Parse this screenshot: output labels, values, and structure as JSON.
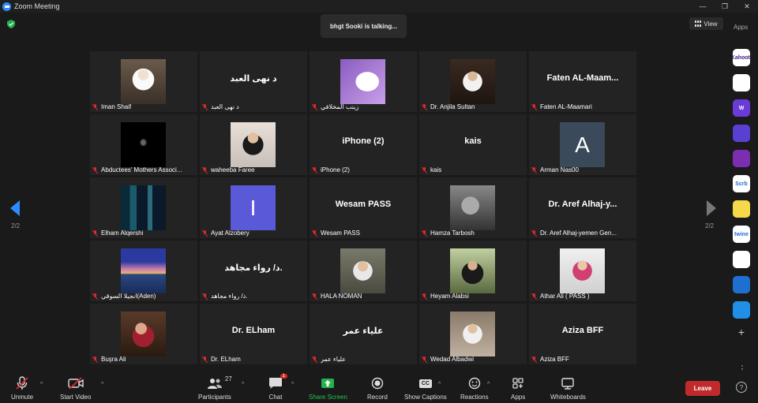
{
  "window": {
    "title": "Zoom Meeting"
  },
  "talking": "bhgt Sooki is talking...",
  "view_label": "View",
  "apps_label": "Apps",
  "pagination": {
    "left": "2/2",
    "right": "2/2"
  },
  "colors": {
    "accent": "#2d8cff",
    "leave": "#c12a2a",
    "muted": "#e02828"
  },
  "tiles": [
    {
      "name": "Iman Shaif",
      "type": "photo",
      "thumb": "woman-hijab-white"
    },
    {
      "name": "د نهى العبد",
      "big": "د نهى العبد",
      "type": "text"
    },
    {
      "name": "زينب المخلافي",
      "type": "photo",
      "thumb": "purple-silhouette"
    },
    {
      "name": "Dr. Anjila Sultan",
      "type": "photo",
      "thumb": "woman-dark"
    },
    {
      "name": "Faten AL-Maamari",
      "big": "Faten AL-Maam...",
      "type": "text"
    },
    {
      "name": "Abductees' Mothers Associ...",
      "type": "photo",
      "thumb": "black-calligraphy"
    },
    {
      "name": "waheeba Faree",
      "type": "photo",
      "thumb": "woman-smile"
    },
    {
      "name": "iPhone (2)",
      "big": "iPhone (2)",
      "type": "text"
    },
    {
      "name": "kais",
      "big": "kais",
      "type": "text"
    },
    {
      "name": "Arman Nas00",
      "type": "avatar",
      "letter": "A",
      "color": "#3a4a5a"
    },
    {
      "name": "Elham Alqershi",
      "type": "photo",
      "thumb": "city-night"
    },
    {
      "name": "Ayat Alzobery",
      "type": "avatar",
      "letter": "I",
      "color": "#5a5ad8"
    },
    {
      "name": "Wesam PASS",
      "big": "Wesam PASS",
      "type": "text"
    },
    {
      "name": "Hamza Tarbosh",
      "type": "photo",
      "thumb": "horse"
    },
    {
      "name": "Dr. Aref Alhaj-yemen  Gen...",
      "big": "Dr. Aref Alhaj-y...",
      "type": "text"
    },
    {
      "name": "انجيلا السوقي(Aden)",
      "type": "photo",
      "thumb": "sunset-sea"
    },
    {
      "name": "د/ رواء مجاهد.",
      "big": "د/ رواء مجاهد.",
      "type": "text"
    },
    {
      "name": "HALA NOMAN",
      "type": "photo",
      "thumb": "woman-glasses"
    },
    {
      "name": "Heyam Alabsi",
      "type": "photo",
      "thumb": "woman-outdoor"
    },
    {
      "name": "Athar Ali ( PASS )",
      "type": "photo",
      "thumb": "woman-pink"
    },
    {
      "name": "Buşra Ali",
      "type": "photo",
      "thumb": "woman-red"
    },
    {
      "name": "Dr. ELham",
      "big": "Dr. ELham",
      "type": "text"
    },
    {
      "name": "علياء عمر",
      "big": "علياء عمر",
      "type": "text"
    },
    {
      "name": "Wedad Albadwi",
      "type": "photo",
      "thumb": "woman-room"
    },
    {
      "name": "Aziza BFF",
      "big": "Aziza BFF",
      "type": "text"
    }
  ],
  "apps_rail": [
    {
      "icon": "kahoot-icon",
      "text": "Kahoot!",
      "bg": "#ffffff",
      "fg": "#46178f"
    },
    {
      "icon": "orange-app-icon",
      "text": "",
      "bg": "#ffffff",
      "fg": "#f26b1d"
    },
    {
      "icon": "wordwall-icon",
      "text": "W",
      "bg": "#6a3bd8",
      "fg": "#ffffff"
    },
    {
      "icon": "chat-bubble-app-icon",
      "text": "",
      "bg": "#5b3fd0",
      "fg": "#ffffff"
    },
    {
      "icon": "video-app-icon",
      "text": "",
      "bg": "#7b2fb0",
      "fg": "#ffffff"
    },
    {
      "icon": "scribe-icon",
      "text": "Scrb",
      "bg": "#ffffff",
      "fg": "#1f6fd1"
    },
    {
      "icon": "smiley-app-icon",
      "text": "",
      "bg": "#f7d84a",
      "fg": "#333333"
    },
    {
      "icon": "twine-icon",
      "text": "twine",
      "bg": "#ffffff",
      "fg": "#1a6fd6"
    },
    {
      "icon": "office-icon",
      "text": "",
      "bg": "#ffffff",
      "fg": "#e2532c"
    },
    {
      "icon": "sync-app-icon",
      "text": "",
      "bg": "#1f6fd1",
      "fg": "#ffffff"
    },
    {
      "icon": "edu-app-icon",
      "text": "",
      "bg": "#1f8fe8",
      "fg": "#ffffff"
    }
  ],
  "toolbar": {
    "unmute": "Unmute",
    "start_video": "Start Video",
    "participants": "Participants",
    "participants_count": "27",
    "chat": "Chat",
    "chat_badge": "1",
    "share_screen": "Share Screen",
    "record": "Record",
    "show_captions": "Show Captions",
    "cc": "CC",
    "reactions": "Reactions",
    "apps": "Apps",
    "whiteboards": "Whiteboards",
    "leave": "Leave",
    "help": "?"
  }
}
